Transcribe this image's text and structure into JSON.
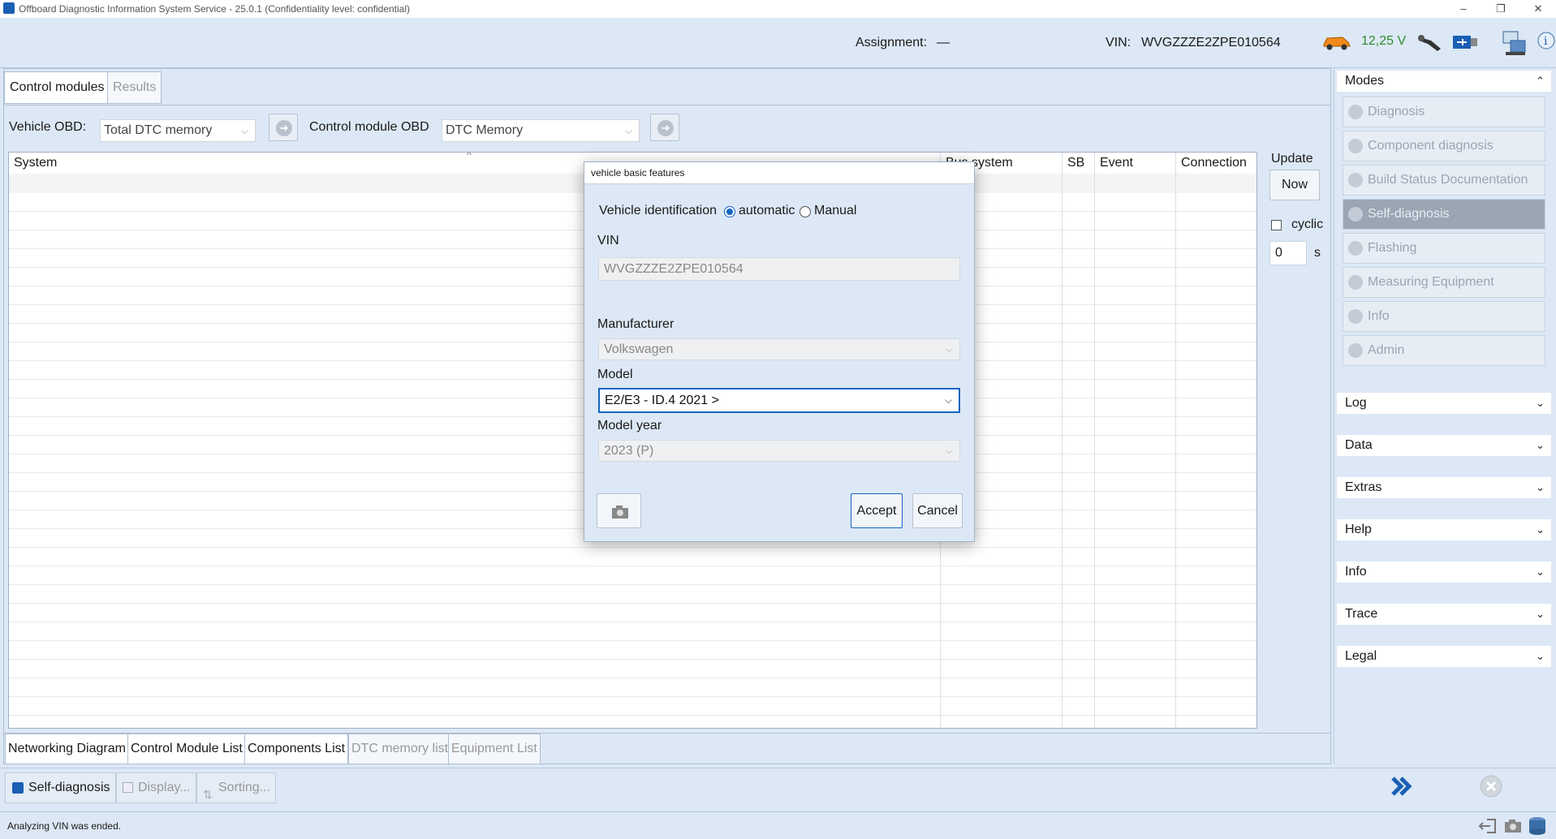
{
  "window": {
    "title": "Offboard Diagnostic Information System Service - 25.0.1 (Confidentiality level: confidential)"
  },
  "header": {
    "assignment_label": "Assignment:",
    "assignment_value": "—",
    "vin_label": "VIN:",
    "vin_value": "WVGZZZE2ZPE010564",
    "voltage": "12,25 V"
  },
  "main": {
    "tabs": [
      {
        "label": "Control modules",
        "active": true
      },
      {
        "label": "Results",
        "active": false
      }
    ],
    "vehicle_obd_label": "Vehicle OBD:",
    "vehicle_obd_value": "Total DTC memory",
    "control_module_obd_label": "Control module OBD",
    "control_module_obd_value": "DTC Memory",
    "table": {
      "columns": [
        "System",
        "Bus system",
        "SB",
        "Event",
        "Connection"
      ]
    },
    "update_label": "Update",
    "now_button": "Now",
    "cyclic_label": "cyclic",
    "cyclic_value": "0",
    "cyclic_unit": "s",
    "bottom_tabs": [
      {
        "label": "Networking Diagram",
        "enabled": true
      },
      {
        "label": "Control Module List",
        "enabled": true
      },
      {
        "label": "Components List",
        "enabled": true
      },
      {
        "label": "DTC memory list",
        "enabled": false
      },
      {
        "label": "Equipment List",
        "enabled": false
      }
    ],
    "toolbar": {
      "self_diagnosis": "Self-diagnosis",
      "display": "Display...",
      "sorting": "Sorting..."
    }
  },
  "right_panel": {
    "modes_header": "Modes",
    "modes": [
      {
        "label": "Diagnosis",
        "selected": false
      },
      {
        "label": "Component diagnosis",
        "selected": false
      },
      {
        "label": "Build Status Documentation",
        "selected": false
      },
      {
        "label": "Self-diagnosis",
        "selected": true
      },
      {
        "label": "Flashing",
        "selected": false
      },
      {
        "label": "Measuring Equipment",
        "selected": false
      },
      {
        "label": "Info",
        "selected": false
      },
      {
        "label": "Admin",
        "selected": false
      }
    ],
    "sections": [
      "Log",
      "Data",
      "Extras",
      "Help",
      "Info",
      "Trace",
      "Legal"
    ]
  },
  "dialog": {
    "title": "vehicle basic features",
    "vehicle_identification_label": "Vehicle identification",
    "option_automatic": "automatic",
    "option_manual": "Manual",
    "vin_label": "VIN",
    "vin_value": "WVGZZZE2ZPE010564",
    "manufacturer_label": "Manufacturer",
    "manufacturer_value": "Volkswagen",
    "model_label": "Model",
    "model_value": "E2/E3 - ID.4 2021 >",
    "model_year_label": "Model year",
    "model_year_value": "2023 (P)",
    "accept_button": "Accept",
    "cancel_button": "Cancel"
  },
  "status": {
    "message": "Analyzing VIN was ended."
  },
  "colors": {
    "background": "#dce8f5",
    "accent": "#1664c0",
    "voltage_text": "#2e8b2e"
  }
}
